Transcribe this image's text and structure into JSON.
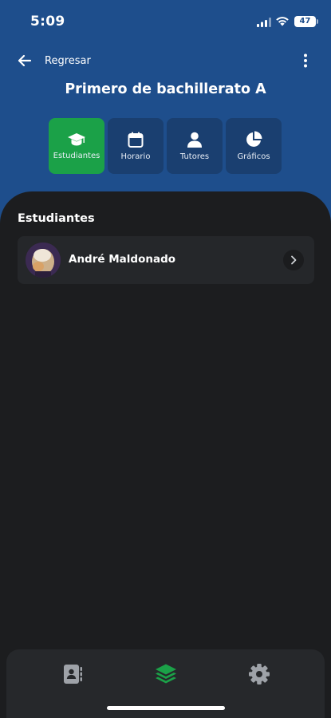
{
  "status_bar": {
    "time": "5:09",
    "battery": "47"
  },
  "header": {
    "back_label": "Regresar",
    "title": "Primero de bachillerato A"
  },
  "tabs": [
    {
      "label": "Estudiantes",
      "icon": "graduation-cap-icon",
      "active": true
    },
    {
      "label": "Horario",
      "icon": "calendar-icon",
      "active": false
    },
    {
      "label": "Tutores",
      "icon": "user-icon",
      "active": false
    },
    {
      "label": "Gráficos",
      "icon": "pie-chart-icon",
      "active": false
    }
  ],
  "main": {
    "section_title": "Estudiantes",
    "students": [
      {
        "name": "André Maldonado"
      }
    ]
  },
  "bottom_nav": [
    {
      "icon": "contacts-book-icon",
      "active": false
    },
    {
      "icon": "layers-icon",
      "active": true
    },
    {
      "icon": "gear-icon",
      "active": false
    }
  ],
  "colors": {
    "header_bg": "#1e4e8c",
    "active_tab": "#1ba148",
    "sheet_bg": "#1c1d1f",
    "accent_green": "#1ba148"
  }
}
